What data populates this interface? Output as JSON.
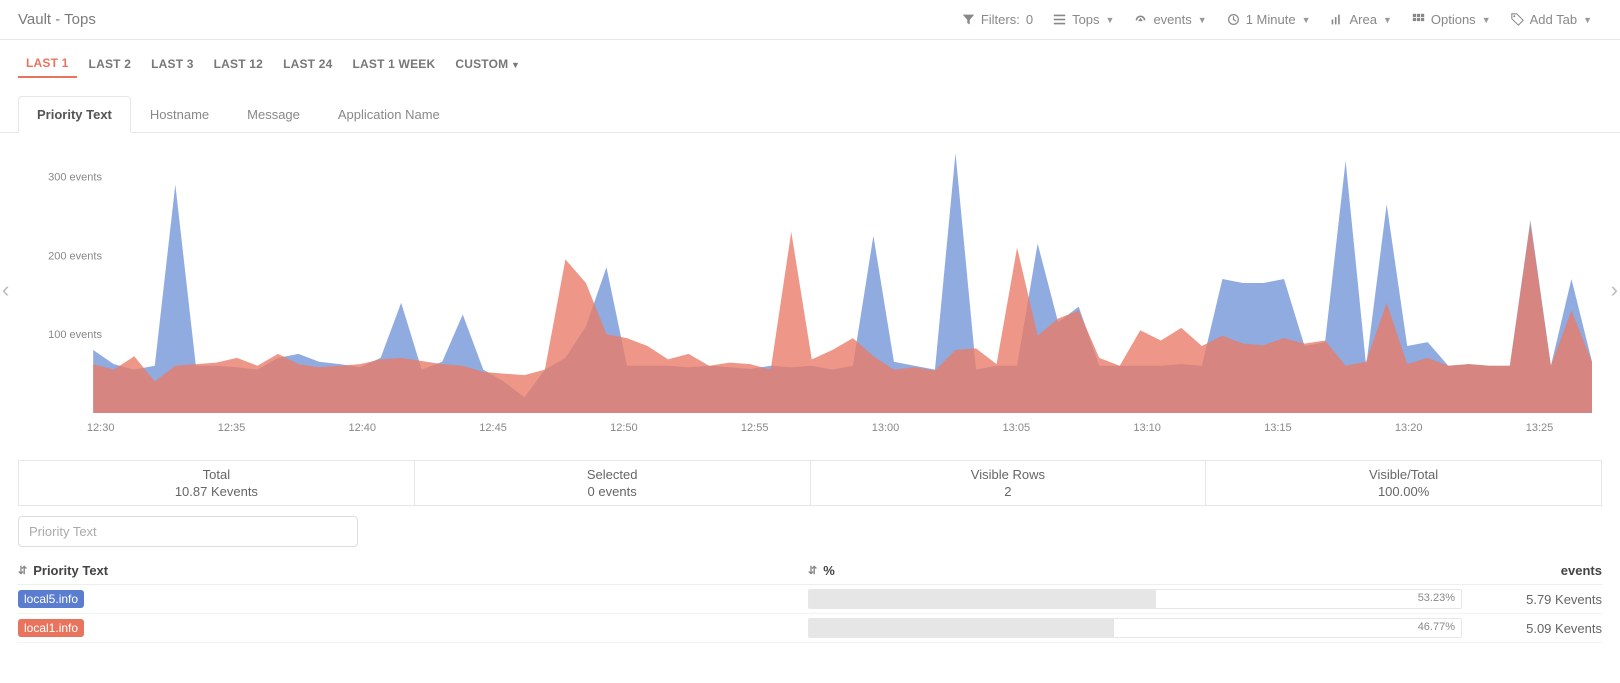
{
  "header": {
    "title": "Vault - Tops",
    "filters": {
      "label": "Filters:",
      "count": 0
    },
    "items": [
      {
        "name": "tops",
        "label": "Tops"
      },
      {
        "name": "events",
        "label": "events"
      },
      {
        "name": "interval",
        "label": "1 Minute"
      },
      {
        "name": "charttype",
        "label": "Area"
      },
      {
        "name": "options",
        "label": "Options"
      },
      {
        "name": "addtab",
        "label": "Add Tab"
      }
    ]
  },
  "timeranges": [
    "LAST 1",
    "LAST 2",
    "LAST 3",
    "LAST 12",
    "LAST 24",
    "LAST 1 WEEK",
    "CUSTOM"
  ],
  "active_timerange": "LAST 1",
  "tabs": [
    "Priority Text",
    "Hostname",
    "Message",
    "Application Name"
  ],
  "active_tab": "Priority Text",
  "chart_data": {
    "type": "area",
    "ylabel_unit": "events",
    "ylim": [
      0,
      330
    ],
    "yticks": [
      100,
      200,
      300
    ],
    "x_categories": [
      "12:30",
      "12:35",
      "12:40",
      "12:45",
      "12:50",
      "12:55",
      "13:00",
      "13:05",
      "13:10",
      "13:15",
      "13:20",
      "13:25"
    ],
    "series": [
      {
        "name": "local5.info",
        "color": "#6b8fd4",
        "values": [
          80,
          62,
          55,
          60,
          290,
          60,
          60,
          58,
          55,
          70,
          75,
          65,
          62,
          58,
          70,
          140,
          55,
          65,
          125,
          55,
          40,
          20,
          55,
          70,
          110,
          185,
          60,
          60,
          60,
          58,
          60,
          58,
          56,
          60,
          58,
          60,
          55,
          60,
          225,
          65,
          60,
          55,
          330,
          55,
          60,
          60,
          215,
          115,
          135,
          60,
          60,
          60,
          60,
          62,
          60,
          170,
          165,
          165,
          170,
          85,
          90,
          320,
          60,
          265,
          85,
          90,
          60,
          62,
          60,
          60,
          245,
          60,
          170,
          65
        ]
      },
      {
        "name": "local1.info",
        "color": "#e97a66",
        "values": [
          62,
          55,
          72,
          40,
          60,
          62,
          64,
          70,
          60,
          75,
          62,
          58,
          60,
          62,
          68,
          70,
          66,
          62,
          60,
          52,
          50,
          48,
          55,
          195,
          165,
          100,
          95,
          85,
          68,
          75,
          60,
          64,
          62,
          55,
          230,
          68,
          80,
          95,
          72,
          55,
          58,
          54,
          80,
          82,
          62,
          210,
          98,
          120,
          130,
          70,
          60,
          105,
          92,
          108,
          85,
          98,
          88,
          86,
          95,
          88,
          92,
          60,
          65,
          140,
          62,
          70,
          60,
          62,
          60,
          60,
          240,
          60,
          130,
          65
        ]
      }
    ]
  },
  "stats": [
    {
      "label": "Total",
      "value": "10.87 Kevents"
    },
    {
      "label": "Selected",
      "value": "0 events"
    },
    {
      "label": "Visible Rows",
      "value": "2"
    },
    {
      "label": "Visible/Total",
      "value": "100.00%"
    }
  ],
  "filter_placeholder": "Priority Text",
  "table": {
    "headers": {
      "col1": "Priority Text",
      "col2": "%",
      "col3": "events"
    },
    "rows": [
      {
        "label": "local5.info",
        "color": "blue",
        "pct": 53.23,
        "pct_label": "53.23%",
        "events": "5.79 Kevents"
      },
      {
        "label": "local1.info",
        "color": "red",
        "pct": 46.77,
        "pct_label": "46.77%",
        "events": "5.09 Kevents"
      }
    ]
  }
}
